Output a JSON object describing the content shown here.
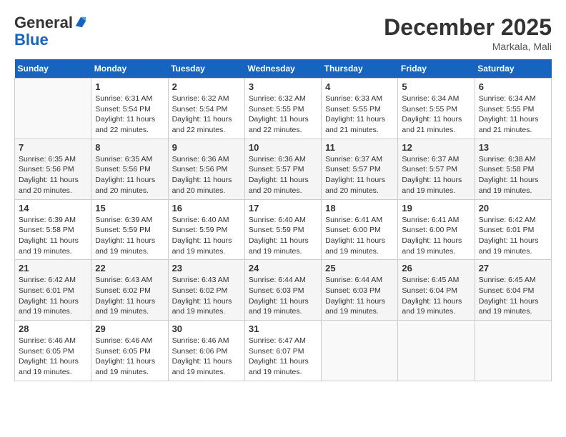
{
  "header": {
    "logo_line1": "General",
    "logo_line2": "Blue",
    "month_title": "December 2025",
    "location": "Markala, Mali"
  },
  "weekdays": [
    "Sunday",
    "Monday",
    "Tuesday",
    "Wednesday",
    "Thursday",
    "Friday",
    "Saturday"
  ],
  "weeks": [
    [
      {
        "day": "",
        "info": ""
      },
      {
        "day": "1",
        "info": "Sunrise: 6:31 AM\nSunset: 5:54 PM\nDaylight: 11 hours\nand 22 minutes."
      },
      {
        "day": "2",
        "info": "Sunrise: 6:32 AM\nSunset: 5:54 PM\nDaylight: 11 hours\nand 22 minutes."
      },
      {
        "day": "3",
        "info": "Sunrise: 6:32 AM\nSunset: 5:55 PM\nDaylight: 11 hours\nand 22 minutes."
      },
      {
        "day": "4",
        "info": "Sunrise: 6:33 AM\nSunset: 5:55 PM\nDaylight: 11 hours\nand 21 minutes."
      },
      {
        "day": "5",
        "info": "Sunrise: 6:34 AM\nSunset: 5:55 PM\nDaylight: 11 hours\nand 21 minutes."
      },
      {
        "day": "6",
        "info": "Sunrise: 6:34 AM\nSunset: 5:55 PM\nDaylight: 11 hours\nand 21 minutes."
      }
    ],
    [
      {
        "day": "7",
        "info": "Sunrise: 6:35 AM\nSunset: 5:56 PM\nDaylight: 11 hours\nand 20 minutes."
      },
      {
        "day": "8",
        "info": "Sunrise: 6:35 AM\nSunset: 5:56 PM\nDaylight: 11 hours\nand 20 minutes."
      },
      {
        "day": "9",
        "info": "Sunrise: 6:36 AM\nSunset: 5:56 PM\nDaylight: 11 hours\nand 20 minutes."
      },
      {
        "day": "10",
        "info": "Sunrise: 6:36 AM\nSunset: 5:57 PM\nDaylight: 11 hours\nand 20 minutes."
      },
      {
        "day": "11",
        "info": "Sunrise: 6:37 AM\nSunset: 5:57 PM\nDaylight: 11 hours\nand 20 minutes."
      },
      {
        "day": "12",
        "info": "Sunrise: 6:37 AM\nSunset: 5:57 PM\nDaylight: 11 hours\nand 19 minutes."
      },
      {
        "day": "13",
        "info": "Sunrise: 6:38 AM\nSunset: 5:58 PM\nDaylight: 11 hours\nand 19 minutes."
      }
    ],
    [
      {
        "day": "14",
        "info": "Sunrise: 6:39 AM\nSunset: 5:58 PM\nDaylight: 11 hours\nand 19 minutes."
      },
      {
        "day": "15",
        "info": "Sunrise: 6:39 AM\nSunset: 5:59 PM\nDaylight: 11 hours\nand 19 minutes."
      },
      {
        "day": "16",
        "info": "Sunrise: 6:40 AM\nSunset: 5:59 PM\nDaylight: 11 hours\nand 19 minutes."
      },
      {
        "day": "17",
        "info": "Sunrise: 6:40 AM\nSunset: 5:59 PM\nDaylight: 11 hours\nand 19 minutes."
      },
      {
        "day": "18",
        "info": "Sunrise: 6:41 AM\nSunset: 6:00 PM\nDaylight: 11 hours\nand 19 minutes."
      },
      {
        "day": "19",
        "info": "Sunrise: 6:41 AM\nSunset: 6:00 PM\nDaylight: 11 hours\nand 19 minutes."
      },
      {
        "day": "20",
        "info": "Sunrise: 6:42 AM\nSunset: 6:01 PM\nDaylight: 11 hours\nand 19 minutes."
      }
    ],
    [
      {
        "day": "21",
        "info": "Sunrise: 6:42 AM\nSunset: 6:01 PM\nDaylight: 11 hours\nand 19 minutes."
      },
      {
        "day": "22",
        "info": "Sunrise: 6:43 AM\nSunset: 6:02 PM\nDaylight: 11 hours\nand 19 minutes."
      },
      {
        "day": "23",
        "info": "Sunrise: 6:43 AM\nSunset: 6:02 PM\nDaylight: 11 hours\nand 19 minutes."
      },
      {
        "day": "24",
        "info": "Sunrise: 6:44 AM\nSunset: 6:03 PM\nDaylight: 11 hours\nand 19 minutes."
      },
      {
        "day": "25",
        "info": "Sunrise: 6:44 AM\nSunset: 6:03 PM\nDaylight: 11 hours\nand 19 minutes."
      },
      {
        "day": "26",
        "info": "Sunrise: 6:45 AM\nSunset: 6:04 PM\nDaylight: 11 hours\nand 19 minutes."
      },
      {
        "day": "27",
        "info": "Sunrise: 6:45 AM\nSunset: 6:04 PM\nDaylight: 11 hours\nand 19 minutes."
      }
    ],
    [
      {
        "day": "28",
        "info": "Sunrise: 6:46 AM\nSunset: 6:05 PM\nDaylight: 11 hours\nand 19 minutes."
      },
      {
        "day": "29",
        "info": "Sunrise: 6:46 AM\nSunset: 6:05 PM\nDaylight: 11 hours\nand 19 minutes."
      },
      {
        "day": "30",
        "info": "Sunrise: 6:46 AM\nSunset: 6:06 PM\nDaylight: 11 hours\nand 19 minutes."
      },
      {
        "day": "31",
        "info": "Sunrise: 6:47 AM\nSunset: 6:07 PM\nDaylight: 11 hours\nand 19 minutes."
      },
      {
        "day": "",
        "info": ""
      },
      {
        "day": "",
        "info": ""
      },
      {
        "day": "",
        "info": ""
      }
    ]
  ]
}
